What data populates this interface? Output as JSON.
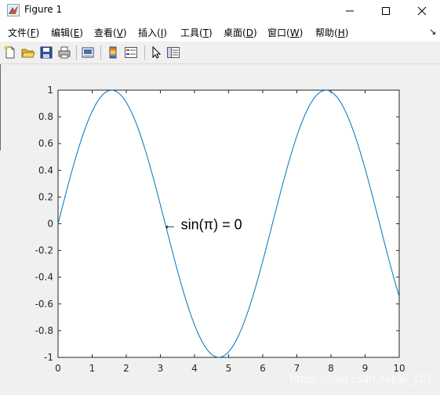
{
  "window": {
    "title": "Figure 1",
    "controls": {
      "minimize": "—",
      "maximize": "☐",
      "close": "✕"
    }
  },
  "menu": [
    {
      "label": "文件(",
      "key": "F",
      "end": ")"
    },
    {
      "label": "编辑(",
      "key": "E",
      "end": ")"
    },
    {
      "label": "查看(",
      "key": "V",
      "end": ")"
    },
    {
      "label": "插入(",
      "key": "I",
      "end": ")"
    },
    {
      "label": "工具(",
      "key": "T",
      "end": ")"
    },
    {
      "label": "桌面(",
      "key": "D",
      "end": ")"
    },
    {
      "label": "窗口(",
      "key": "W",
      "end": ")"
    },
    {
      "label": "帮助(",
      "key": "H",
      "end": ")"
    }
  ],
  "menu_extra": "↘",
  "toolbar": {
    "buttons": [
      "new-figure-icon",
      "open-file-icon",
      "save-icon",
      "print-icon",
      "print-preview-icon",
      "colorbar-icon",
      "legend-icon",
      "edit-plot-icon",
      "property-inspector-icon"
    ]
  },
  "chart_data": {
    "type": "line",
    "function": "sin(x)",
    "x": [
      0,
      0.5,
      1,
      1.5,
      2,
      2.5,
      3,
      3.5,
      4,
      4.5,
      5,
      5.5,
      6,
      6.5,
      7,
      7.5,
      8,
      8.5,
      9,
      9.5,
      10
    ],
    "y": [
      0,
      0.479,
      0.841,
      0.997,
      0.909,
      0.598,
      0.141,
      -0.351,
      -0.757,
      -0.978,
      -0.959,
      -0.706,
      -0.279,
      0.215,
      0.657,
      0.938,
      0.989,
      0.798,
      0.412,
      -0.075,
      -0.544
    ],
    "xlim": [
      0,
      10
    ],
    "ylim": [
      -1,
      1
    ],
    "xticks": [
      "0",
      "1",
      "2",
      "3",
      "4",
      "5",
      "6",
      "7",
      "8",
      "9",
      "10"
    ],
    "yticks": [
      "1",
      "0.8",
      "0.6",
      "0.4",
      "0.2",
      "0",
      "-0.2",
      "-0.4",
      "-0.6",
      "-0.8",
      "-1"
    ],
    "line_color": "#0072bd",
    "annotation": {
      "text": "←  sin(π) = 0",
      "x": 3.1416,
      "y": 0
    },
    "grid": false
  },
  "watermark": "https://blog.csdn.net/jk_101"
}
